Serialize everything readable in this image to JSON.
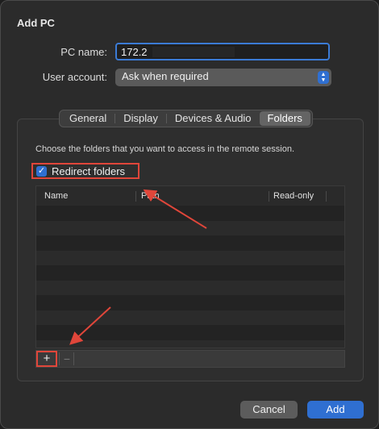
{
  "window": {
    "title": "Add PC"
  },
  "form": {
    "pc_name_label": "PC name:",
    "pc_name_value": "172.2",
    "user_account_label": "User account:",
    "user_account_value": "Ask when required"
  },
  "tabs": [
    {
      "label": "General",
      "active": false
    },
    {
      "label": "Display",
      "active": false
    },
    {
      "label": "Devices & Audio",
      "active": false
    },
    {
      "label": "Folders",
      "active": true
    }
  ],
  "folders": {
    "description": "Choose the folders that you want to access in the remote session.",
    "redirect_label": "Redirect folders",
    "redirect_checked": true,
    "columns": [
      "Name",
      "Path",
      "Read-only"
    ],
    "add_symbol": "+",
    "remove_symbol": "−"
  },
  "buttons": {
    "cancel": "Cancel",
    "add": "Add"
  },
  "colors": {
    "accent": "#2f6fd1",
    "annotation": "#e0463a"
  }
}
